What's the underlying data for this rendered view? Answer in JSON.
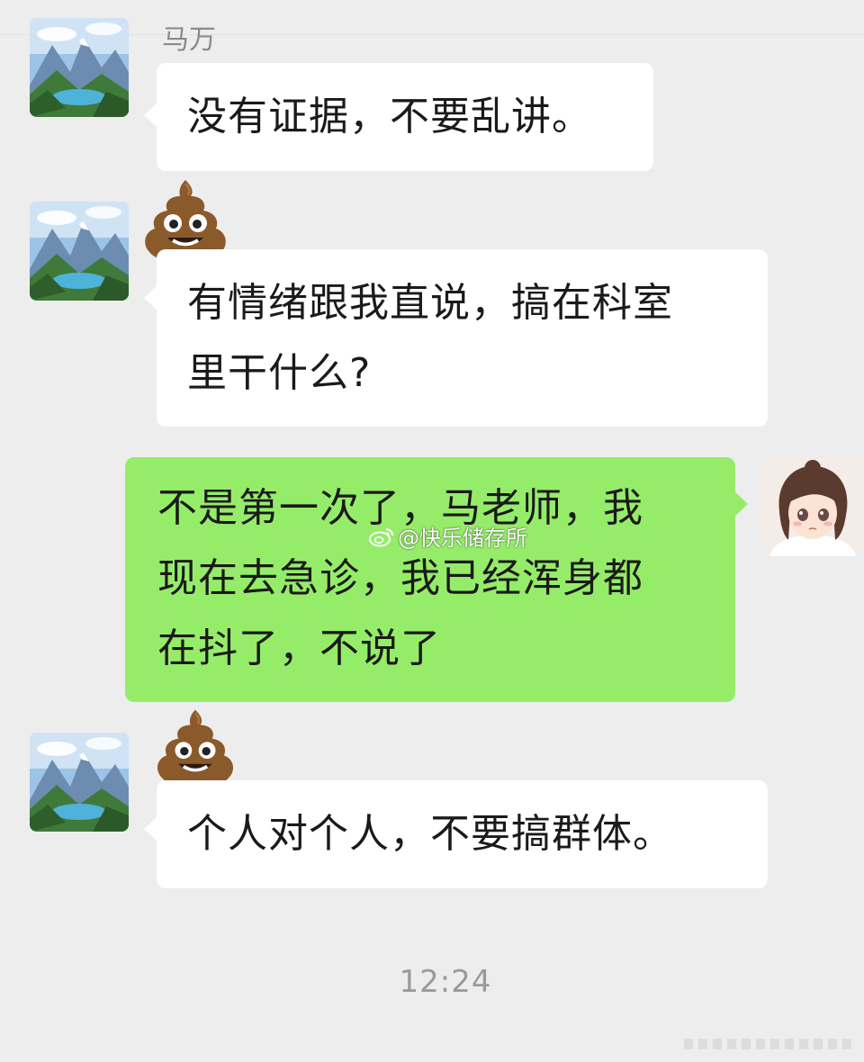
{
  "chat": {
    "messages": [
      {
        "direction": "incoming",
        "sender": "马万",
        "text": "没有证据，不要乱讲。"
      },
      {
        "direction": "incoming",
        "sender": "",
        "reaction": "poop-emoji",
        "lines": [
          "有情绪跟我直说，搞在科室",
          "里干什么?"
        ]
      },
      {
        "direction": "outgoing",
        "lines": [
          "不是第一次了，马老师，我",
          "现在去急诊，我已经浑身都",
          "在抖了，不说了"
        ]
      },
      {
        "direction": "incoming",
        "reaction": "poop-emoji",
        "text": "个人对个人，不要搞群体。"
      }
    ],
    "timestamp": "12:24"
  },
  "watermark": {
    "text": "@快乐储存所",
    "icon": "weibo-icon"
  },
  "colors": {
    "background": "#ededed",
    "incoming_bubble": "#ffffff",
    "outgoing_bubble": "#95ec69",
    "timestamp": "#9a9a9a"
  }
}
